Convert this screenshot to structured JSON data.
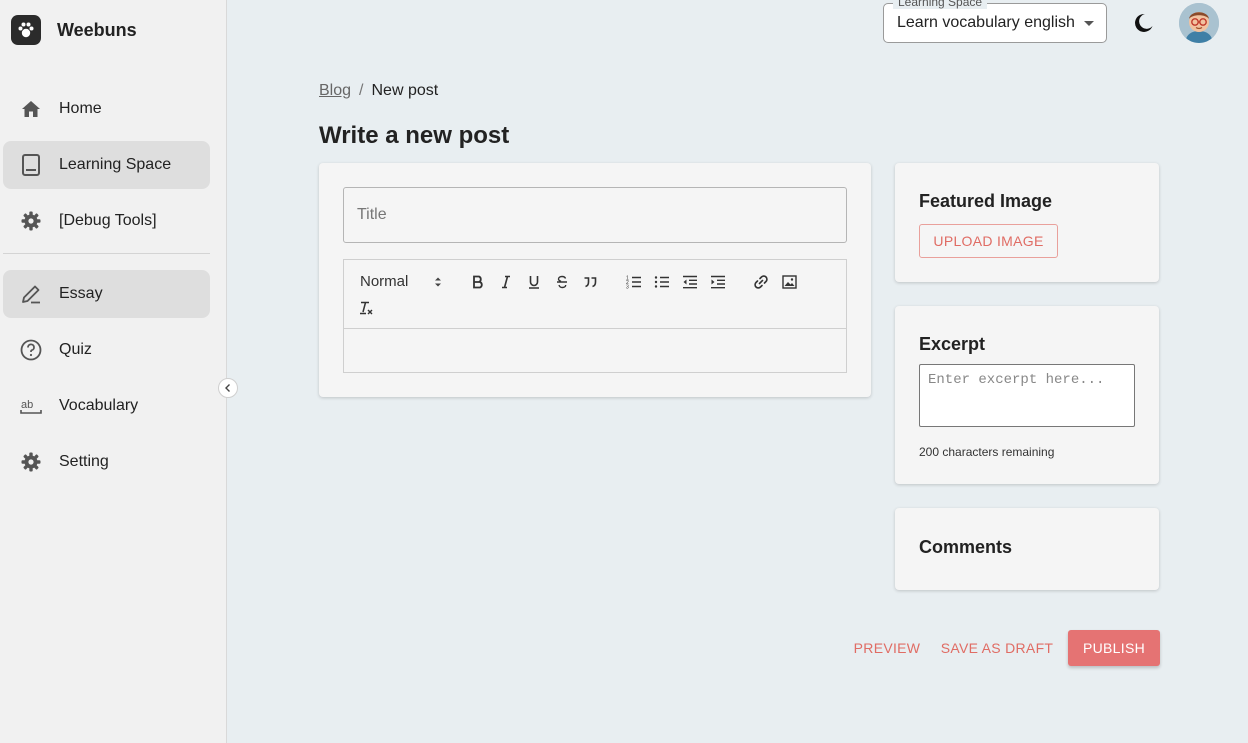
{
  "app": {
    "name": "Weebuns"
  },
  "sidebar": {
    "items": [
      {
        "label": "Home",
        "icon": "home-icon"
      },
      {
        "label": "Learning Space",
        "icon": "book-icon",
        "active": true
      },
      {
        "label": "[Debug Tools]",
        "icon": "gear-icon"
      },
      {
        "label": "Essay",
        "icon": "pen-icon",
        "active": true
      },
      {
        "label": "Quiz",
        "icon": "help-circle-icon"
      },
      {
        "label": "Vocabulary",
        "icon": "ab-icon"
      },
      {
        "label": "Setting",
        "icon": "gear-icon"
      }
    ]
  },
  "topbar": {
    "learning_space_label": "Learning Space",
    "learning_space_value": "Learn vocabulary english"
  },
  "breadcrumb": {
    "parent": "Blog",
    "separator": "/",
    "current": "New post"
  },
  "page": {
    "title": "Write a new post"
  },
  "editor": {
    "title_placeholder": "Title",
    "format_value": "Normal"
  },
  "featured": {
    "heading": "Featured Image",
    "upload_label": "UPLOAD IMAGE"
  },
  "excerpt": {
    "heading": "Excerpt",
    "placeholder": "Enter excerpt here...",
    "remaining": "200 characters remaining"
  },
  "comments": {
    "heading": "Comments"
  },
  "actions": {
    "preview": "PREVIEW",
    "save_draft": "SAVE AS DRAFT",
    "publish": "PUBLISH"
  },
  "colors": {
    "accent": "#e57373",
    "accent_text": "#e06c64",
    "background": "#e8eef1",
    "sidebar": "#f1f1f1"
  }
}
